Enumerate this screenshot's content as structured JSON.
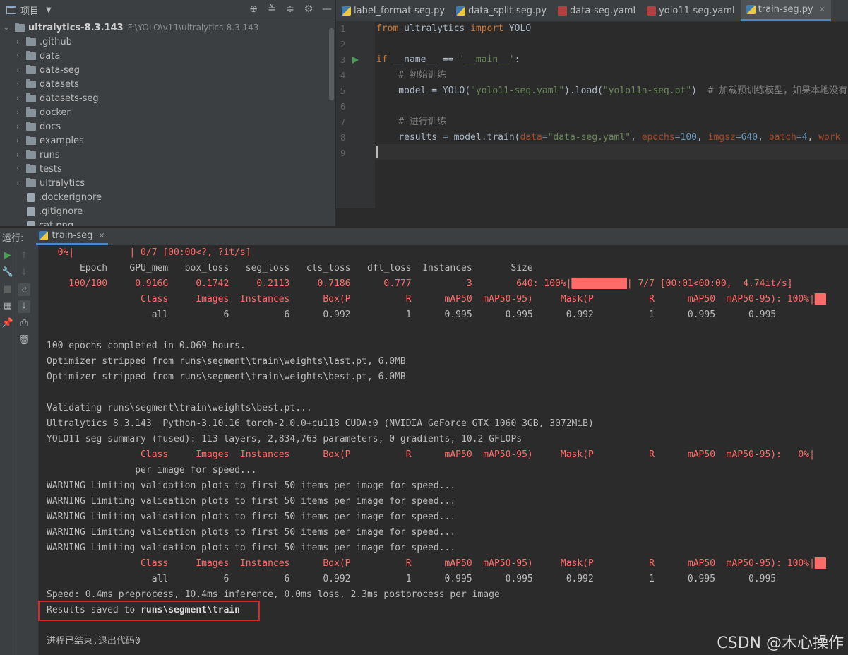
{
  "project": {
    "title": "项目",
    "root": {
      "name": "ultralytics-8.3.143",
      "path": "F:\\YOLO\\v11\\ultralytics-8.3.143"
    },
    "items": [
      {
        "name": ".github",
        "type": "folder"
      },
      {
        "name": "data",
        "type": "folder"
      },
      {
        "name": "data-seg",
        "type": "folder"
      },
      {
        "name": "datasets",
        "type": "folder"
      },
      {
        "name": "datasets-seg",
        "type": "folder"
      },
      {
        "name": "docker",
        "type": "folder"
      },
      {
        "name": "docs",
        "type": "folder"
      },
      {
        "name": "examples",
        "type": "folder"
      },
      {
        "name": "runs",
        "type": "folder"
      },
      {
        "name": "tests",
        "type": "folder"
      },
      {
        "name": "ultralytics",
        "type": "folder"
      },
      {
        "name": ".dockerignore",
        "type": "file"
      },
      {
        "name": ".gitignore",
        "type": "file"
      },
      {
        "name": "cat.png",
        "type": "file"
      }
    ]
  },
  "tabs": [
    {
      "label": "label_format-seg.py",
      "icon": "python-file-icon",
      "active": false
    },
    {
      "label": "data_split-seg.py",
      "icon": "python-file-icon",
      "active": false
    },
    {
      "label": "data-seg.yaml",
      "icon": "yaml-file-icon",
      "active": false
    },
    {
      "label": "yolo11-seg.yaml",
      "icon": "yaml-file-icon",
      "active": false
    },
    {
      "label": "train-seg.py",
      "icon": "python-file-icon",
      "active": true
    }
  ],
  "editor": {
    "lines": [
      "1",
      "2",
      "3",
      "4",
      "5",
      "6",
      "7",
      "8",
      "9"
    ],
    "code": {
      "l1_from": "from",
      "l1_mod": " ultralytics ",
      "l1_import": "import",
      "l1_name": " YOLO",
      "l3_if": "if",
      "l3_rest": " __name__ == ",
      "l3_str": "'__main__'",
      "l3_colon": ":",
      "l4_cmt": "    # 初始训练",
      "l5_a": "    model = YOLO(",
      "l5_s1": "\"yolo11-seg.yaml\"",
      "l5_b": ").load(",
      "l5_s2": "\"yolo11n-seg.pt\"",
      "l5_c": ")  ",
      "l5_cmt": "# 加载预训练模型，如果本地没有",
      "l7_cmt": "    # 进行训练",
      "l8_a": "    results = model.train(",
      "l8_p1": "data",
      "l8_eq1": "=",
      "l8_s1": "\"data-seg.yaml\"",
      "l8_c1": ", ",
      "l8_p2": "epochs",
      "l8_eq2": "=",
      "l8_n2": "100",
      "l8_c2": ", ",
      "l8_p3": "imgsz",
      "l8_eq3": "=",
      "l8_n3": "640",
      "l8_c3": ", ",
      "l8_p4": "batch",
      "l8_eq4": "=",
      "l8_n4": "4",
      "l8_c4": ", ",
      "l8_p5": "work"
    }
  },
  "run": {
    "label": "运行:",
    "tab": "train-seg"
  },
  "console": [
    {
      "text": "  0%|          | 0/7 [00:00<?, ?it/s]",
      "cls": "red"
    },
    {
      "text": "      Epoch    GPU_mem   box_loss   seg_loss   cls_loss   dfl_loss  Instances       Size",
      "cls": ""
    },
    {
      "text": "    100/100     0.916G     0.1742     0.2113     0.7186      0.777          3        640: 100%|",
      "cls": "red",
      "bar": "██████████",
      "tail": "| 7/7 [00:01<00:00,  4.74it/s]"
    },
    {
      "text": "                 Class     Images  Instances      Box(P          R      mAP50  mAP50-95)     Mask(P          R      mAP50  mAP50-95): 100%|",
      "cls": "red",
      "bar": "██",
      "tail": ""
    },
    {
      "text": "                   all          6          6      0.992          1      0.995      0.995      0.992          1      0.995      0.995",
      "cls": ""
    },
    {
      "text": "",
      "cls": ""
    },
    {
      "text": "100 epochs completed in 0.069 hours.",
      "cls": ""
    },
    {
      "text": "Optimizer stripped from runs\\segment\\train\\weights\\last.pt, 6.0MB",
      "cls": ""
    },
    {
      "text": "Optimizer stripped from runs\\segment\\train\\weights\\best.pt, 6.0MB",
      "cls": ""
    },
    {
      "text": "",
      "cls": ""
    },
    {
      "text": "Validating runs\\segment\\train\\weights\\best.pt...",
      "cls": ""
    },
    {
      "text": "Ultralytics 8.3.143  Python-3.10.16 torch-2.0.0+cu118 CUDA:0 (NVIDIA GeForce GTX 1060 3GB, 3072MiB)",
      "cls": ""
    },
    {
      "text": "YOLO11-seg summary (fused): 113 layers, 2,834,763 parameters, 0 gradients, 10.2 GFLOPs",
      "cls": ""
    },
    {
      "text": "                 Class     Images  Instances      Box(P          R      mAP50  mAP50-95)     Mask(P          R      mAP50  mAP50-95):   0%|",
      "cls": "red"
    },
    {
      "text": "                per image for speed...",
      "cls": ""
    },
    {
      "text": "WARNING Limiting validation plots to first 50 items per image for speed...",
      "cls": ""
    },
    {
      "text": "WARNING Limiting validation plots to first 50 items per image for speed...",
      "cls": ""
    },
    {
      "text": "WARNING Limiting validation plots to first 50 items per image for speed...",
      "cls": ""
    },
    {
      "text": "WARNING Limiting validation plots to first 50 items per image for speed...",
      "cls": ""
    },
    {
      "text": "WARNING Limiting validation plots to first 50 items per image for speed...",
      "cls": ""
    },
    {
      "text": "                 Class     Images  Instances      Box(P          R      mAP50  mAP50-95)     Mask(P          R      mAP50  mAP50-95): 100%|",
      "cls": "red",
      "bar": "██",
      "tail": ""
    },
    {
      "text": "                   all          6          6      0.992          1      0.995      0.995      0.992          1      0.995      0.995",
      "cls": ""
    },
    {
      "text": "Speed: 0.4ms preprocess, 10.4ms inference, 0.0ms loss, 2.3ms postprocess per image",
      "cls": ""
    },
    {
      "text": "Results saved to ",
      "cls": "",
      "bold": "runs\\segment\\train"
    },
    {
      "text": "",
      "cls": ""
    },
    {
      "text": "进程已结束,退出代码0",
      "cls": ""
    }
  ],
  "watermark": "CSDN @木心操作"
}
